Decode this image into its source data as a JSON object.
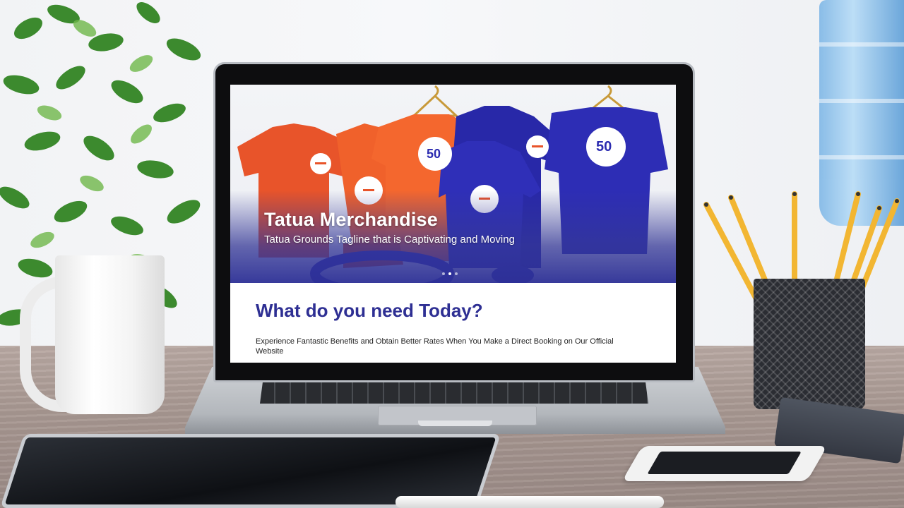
{
  "hero": {
    "title": "Tatua Merchandise",
    "tagline": "Tatua Grounds Tagline that is Captivating and Moving",
    "slide_count": 3,
    "active_slide": 1,
    "shirt_colors": {
      "orange": "#e8542a",
      "blue": "#2b2bb0"
    },
    "badge_text": "50"
  },
  "intro": {
    "title": "What do you need Today?",
    "description": "Experience Fantastic Benefits and Obtain Better Rates When You Make a Direct Booking on Our Official Website"
  },
  "colors": {
    "heading_blue": "#2e2f93",
    "hero_overlay": "#2d3096"
  }
}
